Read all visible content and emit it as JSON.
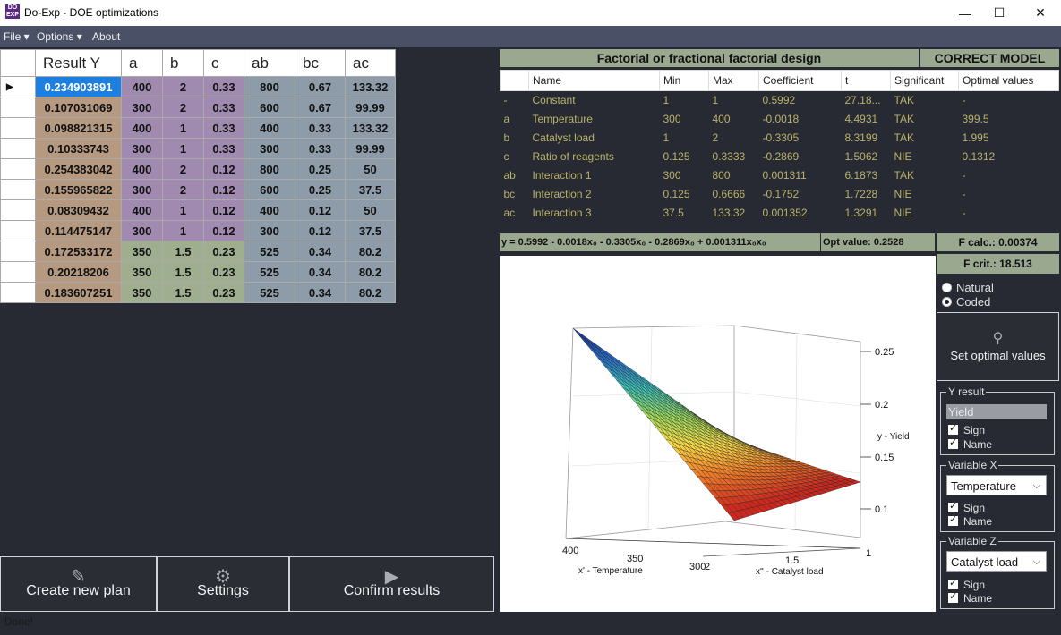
{
  "window": {
    "title": "Do-Exp - DOE optimizations",
    "app_icon_text": "DO EXP",
    "minimize": "—",
    "maximize": "☐",
    "close": "✕"
  },
  "menu": {
    "file": "File ▾",
    "options": "Options ▾",
    "about": "About"
  },
  "grid": {
    "headers": [
      "Result Y",
      "a",
      "b",
      "c",
      "ab",
      "bc",
      "ac"
    ],
    "rows": [
      [
        "0.234903891",
        "400",
        "2",
        "0.33",
        "800",
        "0.67",
        "133.32"
      ],
      [
        "0.107031069",
        "300",
        "2",
        "0.33",
        "600",
        "0.67",
        "99.99"
      ],
      [
        "0.098821315",
        "400",
        "1",
        "0.33",
        "400",
        "0.33",
        "133.32"
      ],
      [
        "0.10333743",
        "300",
        "1",
        "0.33",
        "300",
        "0.33",
        "99.99"
      ],
      [
        "0.254383042",
        "400",
        "2",
        "0.12",
        "800",
        "0.25",
        "50"
      ],
      [
        "0.155965822",
        "300",
        "2",
        "0.12",
        "600",
        "0.25",
        "37.5"
      ],
      [
        "0.08309432",
        "400",
        "1",
        "0.12",
        "400",
        "0.12",
        "50"
      ],
      [
        "0.114475147",
        "300",
        "1",
        "0.12",
        "300",
        "0.12",
        "37.5"
      ],
      [
        "0.172533172",
        "350",
        "1.5",
        "0.23",
        "525",
        "0.34",
        "80.2"
      ],
      [
        "0.20218206",
        "350",
        "1.5",
        "0.23",
        "525",
        "0.34",
        "80.2"
      ],
      [
        "0.183607251",
        "350",
        "1.5",
        "0.23",
        "525",
        "0.34",
        "80.2"
      ]
    ]
  },
  "buttons": {
    "create": "Create new plan",
    "settings": "Settings",
    "confirm": "Confirm results"
  },
  "status": "Done!",
  "design": {
    "title": "Factorial or fractional factorial design",
    "model": "CORRECT MODEL",
    "columns": [
      "",
      "Name",
      "Min",
      "Max",
      "Coefficient",
      "t",
      "Significant",
      "Optimal values"
    ],
    "rows": [
      [
        "-",
        "Constant",
        "1",
        "1",
        "0.5992",
        "27.18...",
        "TAK",
        "-"
      ],
      [
        "a",
        "Temperature",
        "300",
        "400",
        "-0.0018",
        "4.4931",
        "TAK",
        "399.5"
      ],
      [
        "b",
        "Catalyst load",
        "1",
        "2",
        "-0.3305",
        "8.3199",
        "TAK",
        "1.995"
      ],
      [
        "c",
        "Ratio of reagents",
        "0.125",
        "0.3333",
        "-0.2869",
        "1.5062",
        "NIE",
        "0.1312"
      ],
      [
        "ab",
        "Interaction 1",
        "300",
        "800",
        "0.001311",
        "6.1873",
        "TAK",
        "-"
      ],
      [
        "bc",
        "Interaction 2",
        "0.125",
        "0.6666",
        "-0.1752",
        "1.7228",
        "NIE",
        "-"
      ],
      [
        "ac",
        "Interaction 3",
        "37.5",
        "133.32",
        "0.001352",
        "1.3291",
        "NIE",
        "-"
      ]
    ],
    "equation": "y = 0.5992 - 0.0018x₀ - 0.3305x₀ - 0.2869x₀ + 0.001311x₀x₀",
    "opt_value": "Opt value: 0.2528",
    "f_calc": "F calc.: 0.00374",
    "f_crit": "F crit.: 18.513"
  },
  "coding": {
    "natural": "Natural",
    "coded": "Coded"
  },
  "set_optimal": "Set optimal values",
  "y_result": {
    "legend": "Y result",
    "value": "Yield",
    "sign": "Sign",
    "name": "Name"
  },
  "variable_x": {
    "legend": "Variable X",
    "selected": "Temperature",
    "sign": "Sign",
    "name": "Name"
  },
  "variable_z": {
    "legend": "Variable Z",
    "selected": "Catalyst load",
    "sign": "Sign",
    "name": "Name"
  },
  "plot": {
    "z_ticks": [
      "0.25",
      "0.2",
      "0.15",
      "0.1"
    ],
    "z_label": "y - Yield",
    "x_ticks": [
      "400",
      "350",
      "300"
    ],
    "x_label": "x' - Temperature",
    "y_ticks": [
      "2",
      "1.5",
      "1"
    ],
    "y_label": "x'' - Catalyst load"
  }
}
